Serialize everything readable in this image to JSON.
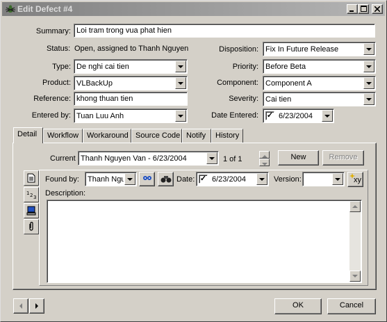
{
  "window": {
    "title": "Edit Defect #4"
  },
  "form": {
    "summary": {
      "label": "Summary:",
      "value": "Loi tram trong vua phat hien"
    },
    "status": {
      "label": "Status:",
      "value": "Open, assigned to Thanh Nguyen"
    },
    "type": {
      "label": "Type:",
      "value": "De nghi cai tien"
    },
    "product": {
      "label": "Product:",
      "value": "VLBackUp"
    },
    "reference": {
      "label": "Reference:",
      "value": "khong thuan tien"
    },
    "entered_by": {
      "label": "Entered by:",
      "value": "Tuan Luu Anh"
    },
    "disposition": {
      "label": "Disposition:",
      "value": "Fix In Future Release"
    },
    "priority": {
      "label": "Priority:",
      "value": "Before Beta"
    },
    "component": {
      "label": "Component:",
      "value": "Component A"
    },
    "severity": {
      "label": "Severity:",
      "value": "Cai tien"
    },
    "date_entered": {
      "label": "Date Entered:",
      "value": "6/23/2004"
    }
  },
  "tabs": [
    "Detail",
    "Workflow",
    "Workaround",
    "Source Code",
    "Notify",
    "History"
  ],
  "detail": {
    "current_label": "Current",
    "current_value": "Thanh Nguyen Van - 6/23/2004",
    "counter": "1 of 1",
    "new_label": "New",
    "remove_label": "Remove",
    "found_by_label": "Found by:",
    "found_by_value": "Thanh Nguyen",
    "date_label": "Date:",
    "date_value": "6/23/2004",
    "version_label": "Version:",
    "version_value": "",
    "description_label": "Description:",
    "xy_label": "xy"
  },
  "footer": {
    "ok_label": "OK",
    "cancel_label": "Cancel"
  },
  "colors": {
    "title_start": "#808080",
    "title_end": "#b5b5b5",
    "face": "#d4d0c8"
  }
}
